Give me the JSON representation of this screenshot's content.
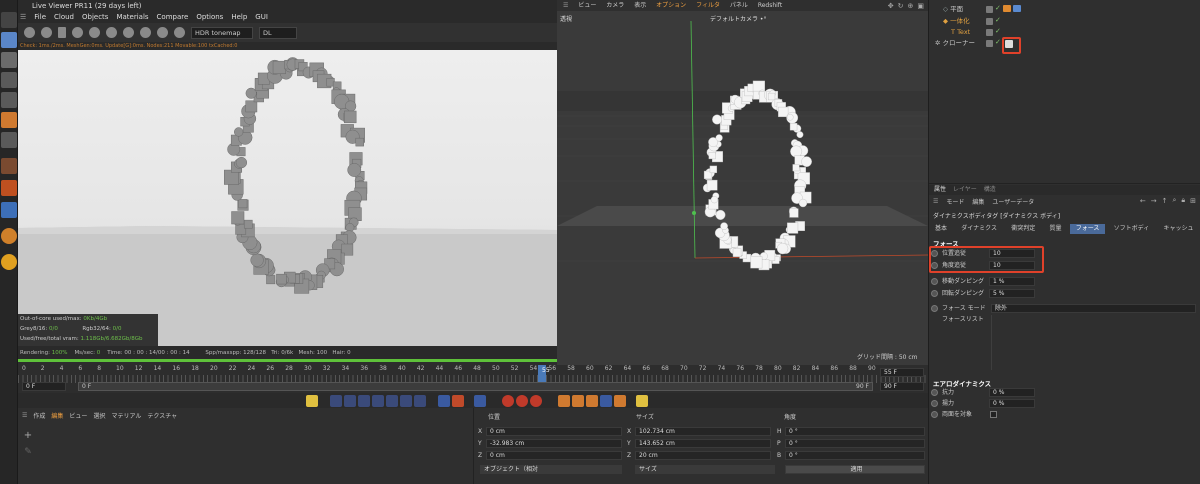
{
  "live_viewer": {
    "title": "Live Viewer PR11 (29 days left)",
    "menu": [
      "File",
      "Cloud",
      "Objects",
      "Materials",
      "Compare",
      "Options",
      "Help",
      "GUI"
    ],
    "tonemap": "HDR tonemap",
    "kernel": "DL",
    "status_line": "Check: 1ms./2ms. MeshGen:0ms. Update[G]:0ms. Nodes:211 Movable:100 txCached:0",
    "info": {
      "outofcore_label": "Out-of-core used/max:",
      "outofcore_value": "0Kb/4Gb",
      "grey_label": "Grey8/16:",
      "grey_value": "0/0",
      "rgb_label": "Rgb32/64:",
      "rgb_value": "0/0",
      "vram_label": "Used/free/total vram:",
      "vram_value": "1.118Gb/6.682Gb/8Gb"
    },
    "bottom": {
      "rendering_label": "Rendering:",
      "rendering": "100%",
      "ms_label": "Ms/sec:",
      "ms": "0",
      "time_label": "Time:",
      "time": "00 : 00 : 14/00 : 00 : 14",
      "spp_label": "Spp/maxspp:",
      "spp": "128/128",
      "tri_label": "Tri:",
      "tri": "0/6k",
      "mesh_label": "Mesh:",
      "mesh": "100",
      "hair_label": "Hair:",
      "hair": "0"
    }
  },
  "viewport": {
    "menu": [
      "ビュー",
      "カメラ",
      "表示",
      "オプション",
      "フィルタ",
      "パネル",
      "Redshift"
    ],
    "label": "透視",
    "camera": "デフォルトカメラ •°",
    "grid": "グリッド間隔 : 50 cm"
  },
  "objects": [
    {
      "name": "平面",
      "color": "#cfcfcf"
    },
    {
      "name": "一体化",
      "color": "#e0a040"
    },
    {
      "name": "Text",
      "color": "#e0a040"
    },
    {
      "name": "クローナー",
      "color": "#cfcfcf"
    }
  ],
  "attributes": {
    "top_tabs": [
      "属性",
      "レイヤー",
      "構造"
    ],
    "mode_items": [
      "モード",
      "編集",
      "ユーザーデータ"
    ],
    "tag_title": "ダイナミクスボディタグ [ダイナミクス ボディ]",
    "tabs": [
      "基本",
      "ダイナミクス",
      "衝突判定",
      "質量",
      "フォース",
      "ソフトボディ",
      "キャッシュ"
    ],
    "active_tab": "フォース",
    "section": "フォース",
    "params": [
      {
        "label": "位置追従",
        "value": "10"
      },
      {
        "label": "角度追従",
        "value": "10"
      },
      {
        "label": "移動ダンピング",
        "value": "1 %"
      },
      {
        "label": "回転ダンピング",
        "value": "5 %"
      }
    ],
    "force_mode_label": "フォース モード",
    "force_mode_value": "除外",
    "force_list_label": "フォースリスト",
    "aero_title": "エアロダイナミクス",
    "aero": [
      {
        "label": "抗力",
        "value": "0 %"
      },
      {
        "label": "揚力",
        "value": "0 %"
      },
      {
        "label": "両面を対象",
        "value": ""
      }
    ]
  },
  "timeline": {
    "ticks": [
      "0",
      "2",
      "4",
      "6",
      "8",
      "10",
      "12",
      "14",
      "16",
      "18",
      "20",
      "22",
      "24",
      "26",
      "28",
      "30",
      "32",
      "34",
      "36",
      "38",
      "40",
      "42",
      "44",
      "46",
      "48",
      "50",
      "52",
      "54",
      "56",
      "58",
      "60",
      "62",
      "64",
      "66",
      "68",
      "70",
      "72",
      "74",
      "76",
      "78",
      "80",
      "82",
      "84",
      "86",
      "88",
      "90"
    ],
    "current": "55",
    "current_frame": "55 F",
    "start": "0 F",
    "start2": "0 F",
    "end": "90 F",
    "end2": "90 F"
  },
  "material": {
    "menu": [
      "作成",
      "編集",
      "ビュー",
      "選択",
      "マテリアル",
      "テクスチャ"
    ]
  },
  "coords": {
    "headers": [
      "位置",
      "サイズ",
      "角度"
    ],
    "rows": [
      {
        "axis": "X",
        "pos": "0 cm",
        "saxis": "X",
        "size": "102.734 cm",
        "raxis": "H",
        "rot": "0 °"
      },
      {
        "axis": "Y",
        "pos": "-32.983 cm",
        "saxis": "Y",
        "size": "143.652 cm",
        "raxis": "P",
        "rot": "0 °"
      },
      {
        "axis": "Z",
        "pos": "0 cm",
        "saxis": "Z",
        "size": "20 cm",
        "raxis": "B",
        "rot": "0 °"
      }
    ],
    "mode": "オブジェクト（相対",
    "size_mode": "サイズ",
    "apply": "適用"
  }
}
